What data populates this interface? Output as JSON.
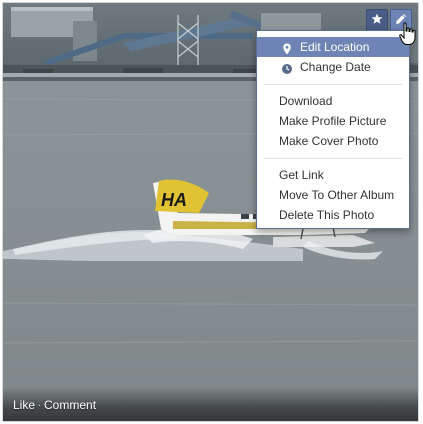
{
  "photo": {
    "description_icon": "seaplane-photo"
  },
  "actions": {
    "like_label": "Like",
    "separator": "·",
    "comment_label": "Comment"
  },
  "toolbar": {
    "star_icon": "star-icon",
    "edit_icon": "pencil-icon"
  },
  "menu": {
    "groups": [
      [
        {
          "label": "Edit Location",
          "icon": "location-pin-icon",
          "active": true
        },
        {
          "label": "Change Date",
          "icon": "clock-icon",
          "active": false
        }
      ],
      [
        {
          "label": "Download"
        },
        {
          "label": "Make Profile Picture"
        },
        {
          "label": "Make Cover Photo"
        }
      ],
      [
        {
          "label": "Get Link"
        },
        {
          "label": "Move To Other Album"
        },
        {
          "label": "Delete This Photo"
        }
      ]
    ]
  },
  "colors": {
    "menu_highlight": "#6d84b4",
    "menu_border": "#5b6e94",
    "star_button": "#4a5d86",
    "edit_button": "#6d84b4"
  }
}
